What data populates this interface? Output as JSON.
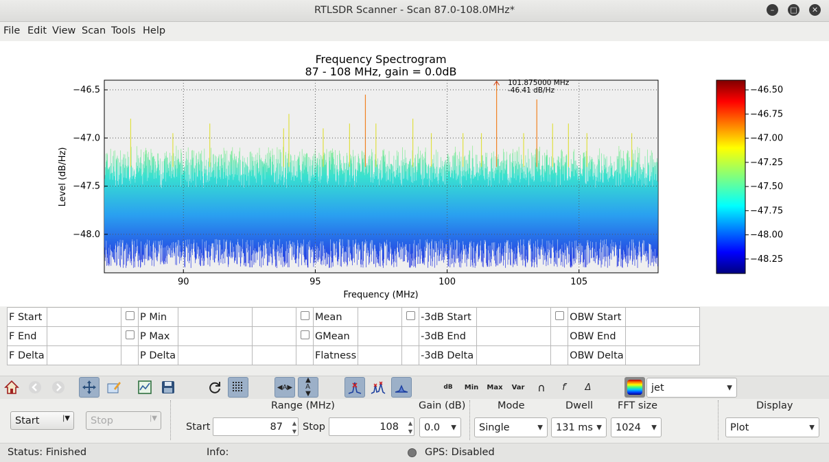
{
  "window": {
    "title": "RTLSDR Scanner - Scan 87.0-108.0MHz*"
  },
  "menu": [
    "File",
    "Edit",
    "View",
    "Scan",
    "Tools",
    "Help"
  ],
  "chart_data": {
    "type": "line",
    "title": "Frequency Spectrogram",
    "subtitle": "87 - 108 MHz, gain = 0.0dB",
    "xlabel": "Frequency (MHz)",
    "ylabel": "Level (dB/Hz)",
    "xlim": [
      87,
      108
    ],
    "ylim": [
      -48.4,
      -46.4
    ],
    "xticks": [
      "90",
      "95",
      "100",
      "105"
    ],
    "yticks": [
      "−46.5",
      "−47.0",
      "−47.5",
      "−48.0"
    ],
    "grid": true,
    "peak_annotation": {
      "freq": 101.875,
      "level": -46.41,
      "label1": "101.875000 MHz",
      "label2": "-46.41 dB/Hz"
    },
    "spikes": [
      [
        88.0,
        -46.8
      ],
      [
        89.6,
        -46.95
      ],
      [
        91.0,
        -46.85
      ],
      [
        93.8,
        -46.9
      ],
      [
        94.0,
        -46.75
      ],
      [
        95.3,
        -46.9
      ],
      [
        96.3,
        -46.85
      ],
      [
        96.9,
        -46.55
      ],
      [
        97.3,
        -46.85
      ],
      [
        98.7,
        -46.8
      ],
      [
        99.4,
        -46.95
      ],
      [
        100.6,
        -46.95
      ],
      [
        101.3,
        -46.95
      ],
      [
        101.875,
        -46.41
      ],
      [
        102.9,
        -46.95
      ],
      [
        103.4,
        -46.6
      ],
      [
        104.0,
        -46.85
      ],
      [
        104.6,
        -46.85
      ],
      [
        105.3,
        -46.95
      ],
      [
        107.0,
        -46.95
      ]
    ],
    "colorbar": {
      "colormap": "jet",
      "min": -48.4,
      "max": -46.4,
      "ticks": [
        "−46.50",
        "−46.75",
        "−47.00",
        "−47.25",
        "−47.50",
        "−47.75",
        "−48.00",
        "−48.25"
      ]
    }
  },
  "measurements": {
    "rows": [
      [
        "F Start",
        "P Min",
        "Mean",
        "-3dB Start",
        "OBW Start"
      ],
      [
        "F End",
        "P Max",
        "GMean",
        "-3dB End",
        "OBW End"
      ],
      [
        "F Delta",
        "P Delta",
        "Flatness",
        "-3dB Delta",
        "OBW Delta"
      ]
    ]
  },
  "toolbar": {
    "icons": [
      "home-icon",
      "back-icon",
      "forward-icon",
      "pan-icon",
      "edit-axes-icon",
      "subplot-icon",
      "save-icon",
      "refresh-icon",
      "grid-icon",
      "autoscale-x-icon",
      "autoscale-y-icon",
      "peak-icon",
      "peaks-icon",
      "fill-icon"
    ],
    "text_buttons": [
      "dB",
      "Min",
      "Max",
      "Var",
      "∩",
      "f′",
      "Δ"
    ],
    "colormap": "jet"
  },
  "controls": {
    "start_button": "Start",
    "stop_button": "Stop",
    "range_label": "Range (MHz)",
    "start_label": "Start",
    "start_value": "87",
    "stop_label": "Stop",
    "stop_value": "108",
    "gain_label": "Gain (dB)",
    "gain_value": "0.0",
    "mode_label": "Mode",
    "mode_value": "Single",
    "dwell_label": "Dwell",
    "dwell_value": "131 ms",
    "fft_label": "FFT size",
    "fft_value": "1024",
    "display_label": "Display",
    "display_value": "Plot"
  },
  "status": {
    "status": "Status: Finished",
    "info": "Info:",
    "gps": "GPS: Disabled"
  }
}
